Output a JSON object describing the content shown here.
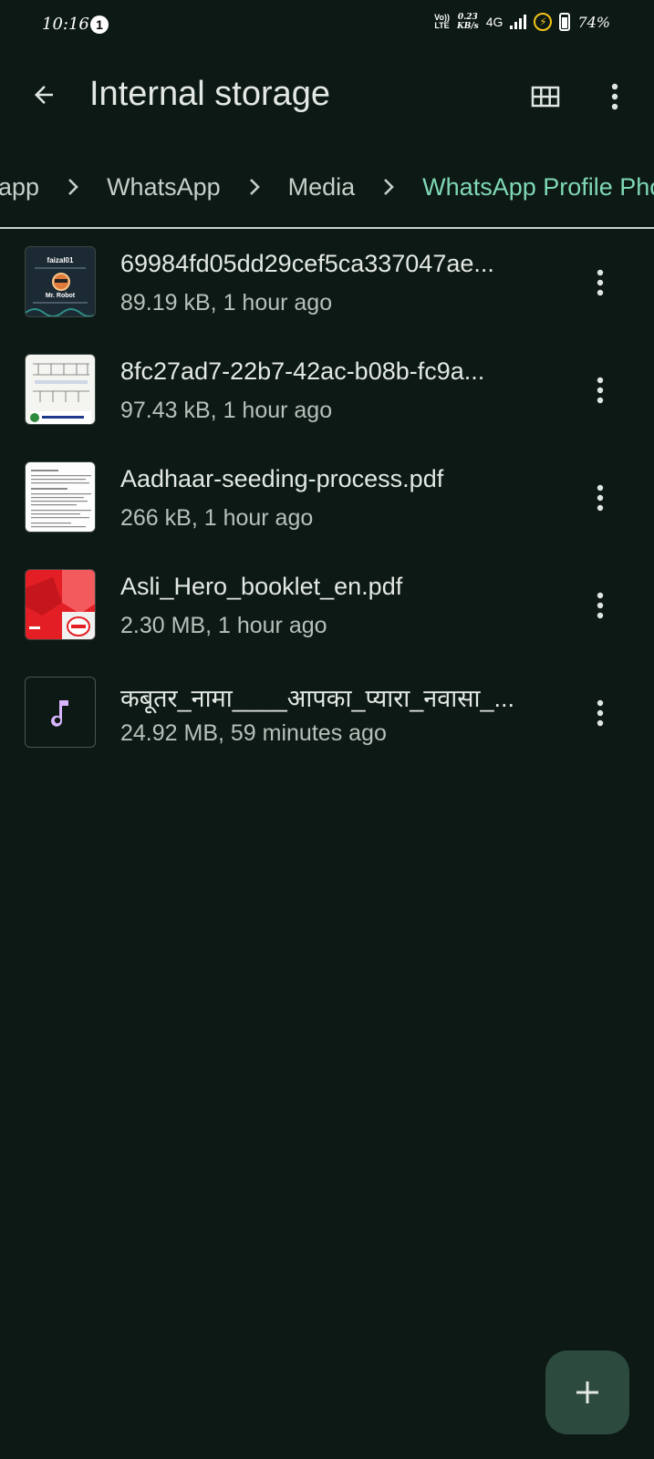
{
  "status_bar": {
    "time": "10:16",
    "notification_count": "1",
    "volte_top": "Vo))",
    "volte_bottom": "LTE",
    "speed_value": "0.23",
    "speed_unit": "KB/s",
    "network": "4G",
    "battery": "74%"
  },
  "app_bar": {
    "title": "Internal storage",
    "back_icon": "arrow-back-icon",
    "view_icon": "grid-view-icon",
    "more_icon": "more-vert-icon"
  },
  "breadcrumb": {
    "items": [
      "app",
      "WhatsApp",
      "Media",
      "WhatsApp Profile Pho"
    ],
    "active_color": "#7fd8b5"
  },
  "files": [
    {
      "name": "69984fd05dd29cef5ca337047ae...",
      "meta": "89.19 kB, 1 hour ago",
      "thumb_text_1": "faizal01",
      "thumb_text_2": "Mr. Robot"
    },
    {
      "name": "8fc27ad7-22b7-42ac-b08b-fc9a...",
      "meta": "97.43 kB, 1 hour ago"
    },
    {
      "name": "Aadhaar-seeding-process.pdf",
      "meta": "266 kB, 1 hour ago"
    },
    {
      "name": "Asli_Hero_booklet_en.pdf",
      "meta": "2.30 MB, 1 hour ago"
    },
    {
      "name": "कबूतर_नामा____आपका_प्यारा_नवासा_...",
      "meta": "24.92 MB, 59 minutes ago",
      "icon": "music-note-icon"
    }
  ],
  "fab": {
    "icon": "plus-icon"
  },
  "colors": {
    "background": "#0d1914",
    "fab": "#2d4a3f",
    "music_icon": "#d8b4fe"
  }
}
